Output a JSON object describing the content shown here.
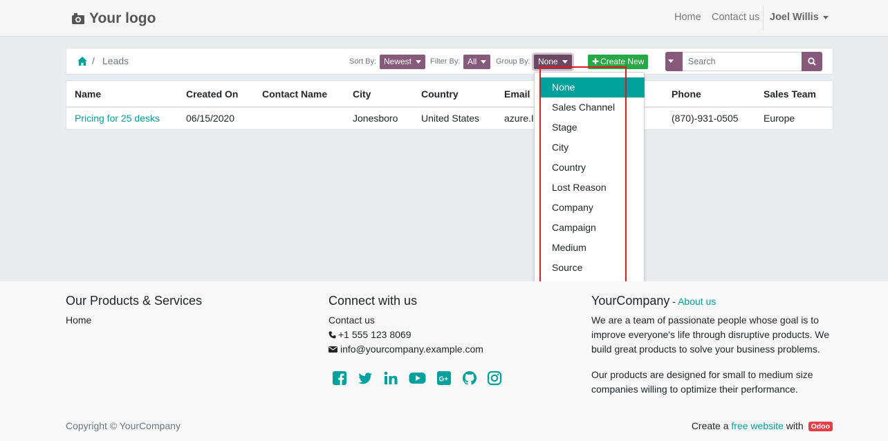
{
  "header": {
    "logo_text": "Your logo",
    "nav": [
      "Home",
      "Contact us"
    ],
    "user": "Joel Willis"
  },
  "toolbar": {
    "breadcrumb_current": "Leads",
    "breadcrumb_separator": "/",
    "sort_label": "Sort By:",
    "sort_value": "Newest",
    "filter_label": "Filter By:",
    "filter_value": "All",
    "group_label": "Group By:",
    "group_value": "None",
    "create_label": "Create New",
    "search_placeholder": "Search"
  },
  "table": {
    "columns": [
      "Name",
      "Created On",
      "Contact Name",
      "City",
      "Country",
      "Email",
      "Phone",
      "Sales Team"
    ],
    "rows": [
      {
        "name": "Pricing for 25 desks",
        "created_on": "06/15/2020",
        "contact_name": "",
        "city": "Jonesboro",
        "country": "United States",
        "email": "azure.In",
        "phone": "(870)-931-0505",
        "sales_team": "Europe"
      }
    ]
  },
  "group_by_menu": {
    "selected": "None",
    "options": [
      "None",
      "Sales Channel",
      "Stage",
      "City",
      "Country",
      "Lost Reason",
      "Company",
      "Campaign",
      "Medium",
      "Source"
    ]
  },
  "footer": {
    "col1_title": "Our Products & Services",
    "col1_link": "Home",
    "col2_title": "Connect with us",
    "col2_link": "Contact us",
    "phone": "+1 555 123 8069",
    "email": "info@yourcompany.example.com",
    "col3_title": "YourCompany",
    "col3_dash": " - ",
    "col3_link": "About us",
    "about_p1": "We are a team of passionate people whose goal is to improve everyone's life through disruptive products. We build great products to solve your business problems.",
    "about_p2": "Our products are designed for small to medium size companies willing to optimize their performance.",
    "copyright": "Copyright © YourCompany",
    "powered_prefix": "Create a ",
    "powered_link": "free website",
    "powered_mid": " with ",
    "powered_badge": "Odoo",
    "social_icons": [
      "facebook-icon",
      "twitter-icon",
      "linkedin-icon",
      "youtube-icon",
      "google-plus-icon",
      "github-icon",
      "instagram-icon"
    ]
  },
  "colors": {
    "accent": "#00a09d",
    "primary": "#875a7b",
    "success": "#28a745",
    "highlight_box": "#e0191e"
  }
}
